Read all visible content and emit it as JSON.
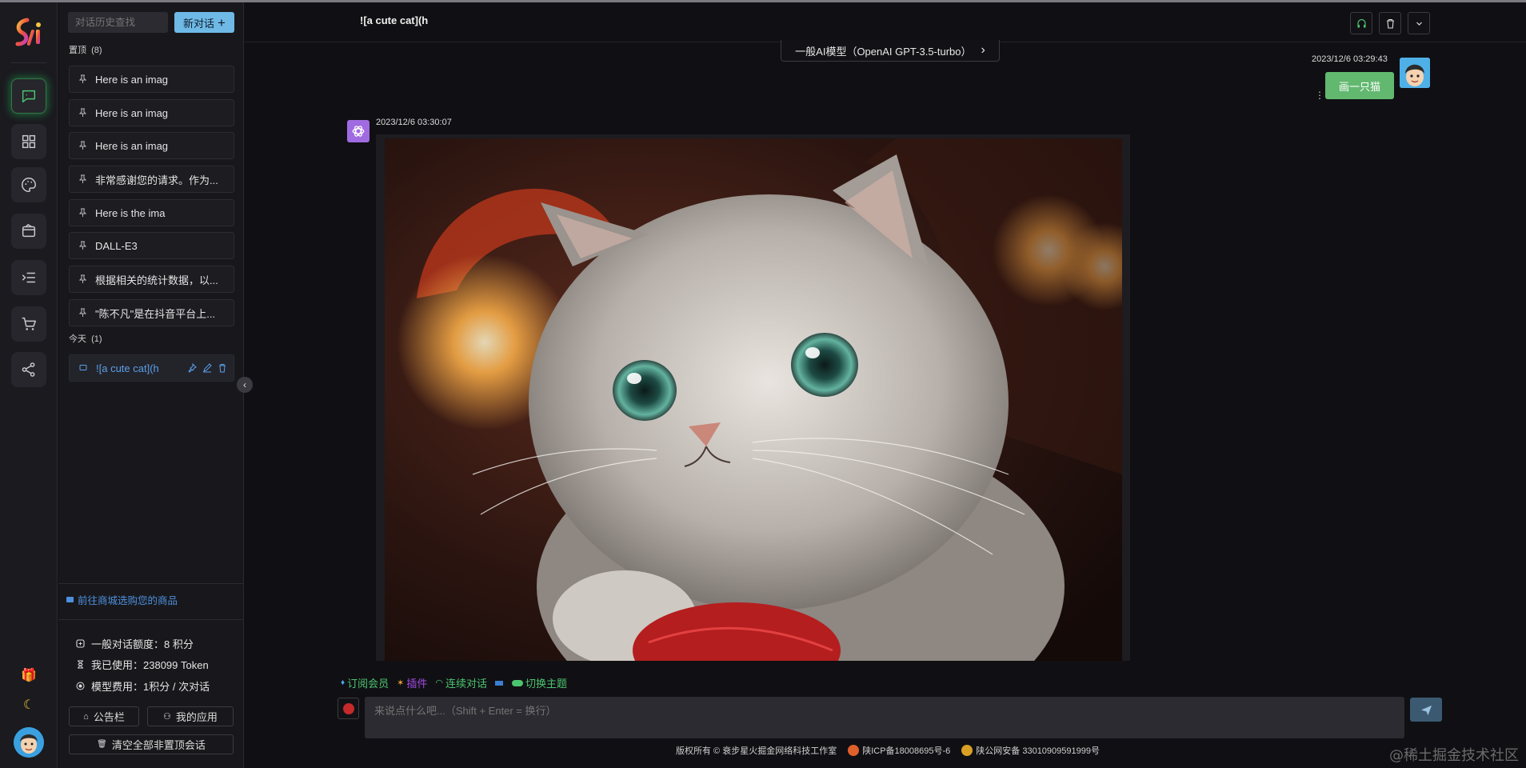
{
  "app": {
    "logo_text": "Si"
  },
  "sidebar": {
    "search_placeholder": "对话历史查找",
    "new_chat_label": "新对话",
    "pinned_group": {
      "label": "置顶",
      "count": "(8)"
    },
    "today_group": {
      "label": "今天",
      "count": "(1)"
    },
    "pinned": [
      {
        "title": "Here is an imag"
      },
      {
        "title": "Here is an imag"
      },
      {
        "title": "Here is an imag"
      },
      {
        "title": "非常感谢您的请求。作为..."
      },
      {
        "title": "Here is the ima"
      },
      {
        "title": "DALL-E3"
      },
      {
        "title": "根据相关的统计数据，以..."
      },
      {
        "title": "\"陈不凡\"是在抖音平台上..."
      }
    ],
    "today": [
      {
        "title": "![a cute cat](h"
      }
    ],
    "shop_link": "前往商城选购您的商品",
    "stats": {
      "quota_label": "一般对话额度：",
      "quota_value": "8 积分",
      "used_label": "我已使用：",
      "used_value": "238099 Token",
      "fee_label": "模型费用：",
      "fee_value": "1积分 / 次对话"
    },
    "buttons": {
      "notice": "公告栏",
      "my_apps": "我的应用",
      "clear_all": "清空全部非置顶会话"
    }
  },
  "header": {
    "title": "![a cute cat](h"
  },
  "model_selector": {
    "label": "一般AI模型（OpenAI GPT-3.5-turbo）"
  },
  "messages": {
    "user": {
      "time": "2023/12/6 03:29:43",
      "text": "画一只猫"
    },
    "assistant": {
      "time": "2023/12/6 03:30:07",
      "image_alt": "a cute cat"
    }
  },
  "toolbar": {
    "subscribe": "订阅会员",
    "plugins": "插件",
    "continuous": "连续对话",
    "theme": "切换主题"
  },
  "input": {
    "placeholder": "来说点什么吧...（Shift + Enter = 换行）"
  },
  "footer": {
    "copyright": "版权所有 © 衰步星火掘金网络科技工作室",
    "icp": "陕ICP备18008695号-6",
    "police": "陕公网安备 33010909591999号"
  },
  "watermark": "@稀土掘金技术社区",
  "colors": {
    "accent": "#6fb9e6",
    "user_bubble": "#63b86f",
    "link": "#4d90dd",
    "active_green": "#4cc46f"
  }
}
